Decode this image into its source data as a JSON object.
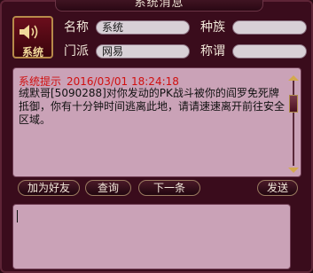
{
  "window": {
    "title": "系统消息"
  },
  "sender": {
    "avatar_label": "系统",
    "name_label": "名称",
    "name_value": "系统",
    "race_label": "种族",
    "race_value": "",
    "faction_label": "门派",
    "faction_value": "网易",
    "title_label": "称谓",
    "title_value": ""
  },
  "message": {
    "header": "系统提示",
    "timestamp": "2016/03/01 18:24:18",
    "body": "绒默哥[5090288]对你发动的PK战斗被你的阎罗免死牌抵御，你有十分钟时间逃离此地，请请速速离开前往安全区域。"
  },
  "buttons": {
    "add_friend": "加为好友",
    "inspect": "查询",
    "next": "下一条",
    "send": "发送"
  },
  "compose": {
    "value": ""
  },
  "colors": {
    "frame": "#3a0c1c",
    "panel": "#caa2b7",
    "alert": "#d01010"
  }
}
